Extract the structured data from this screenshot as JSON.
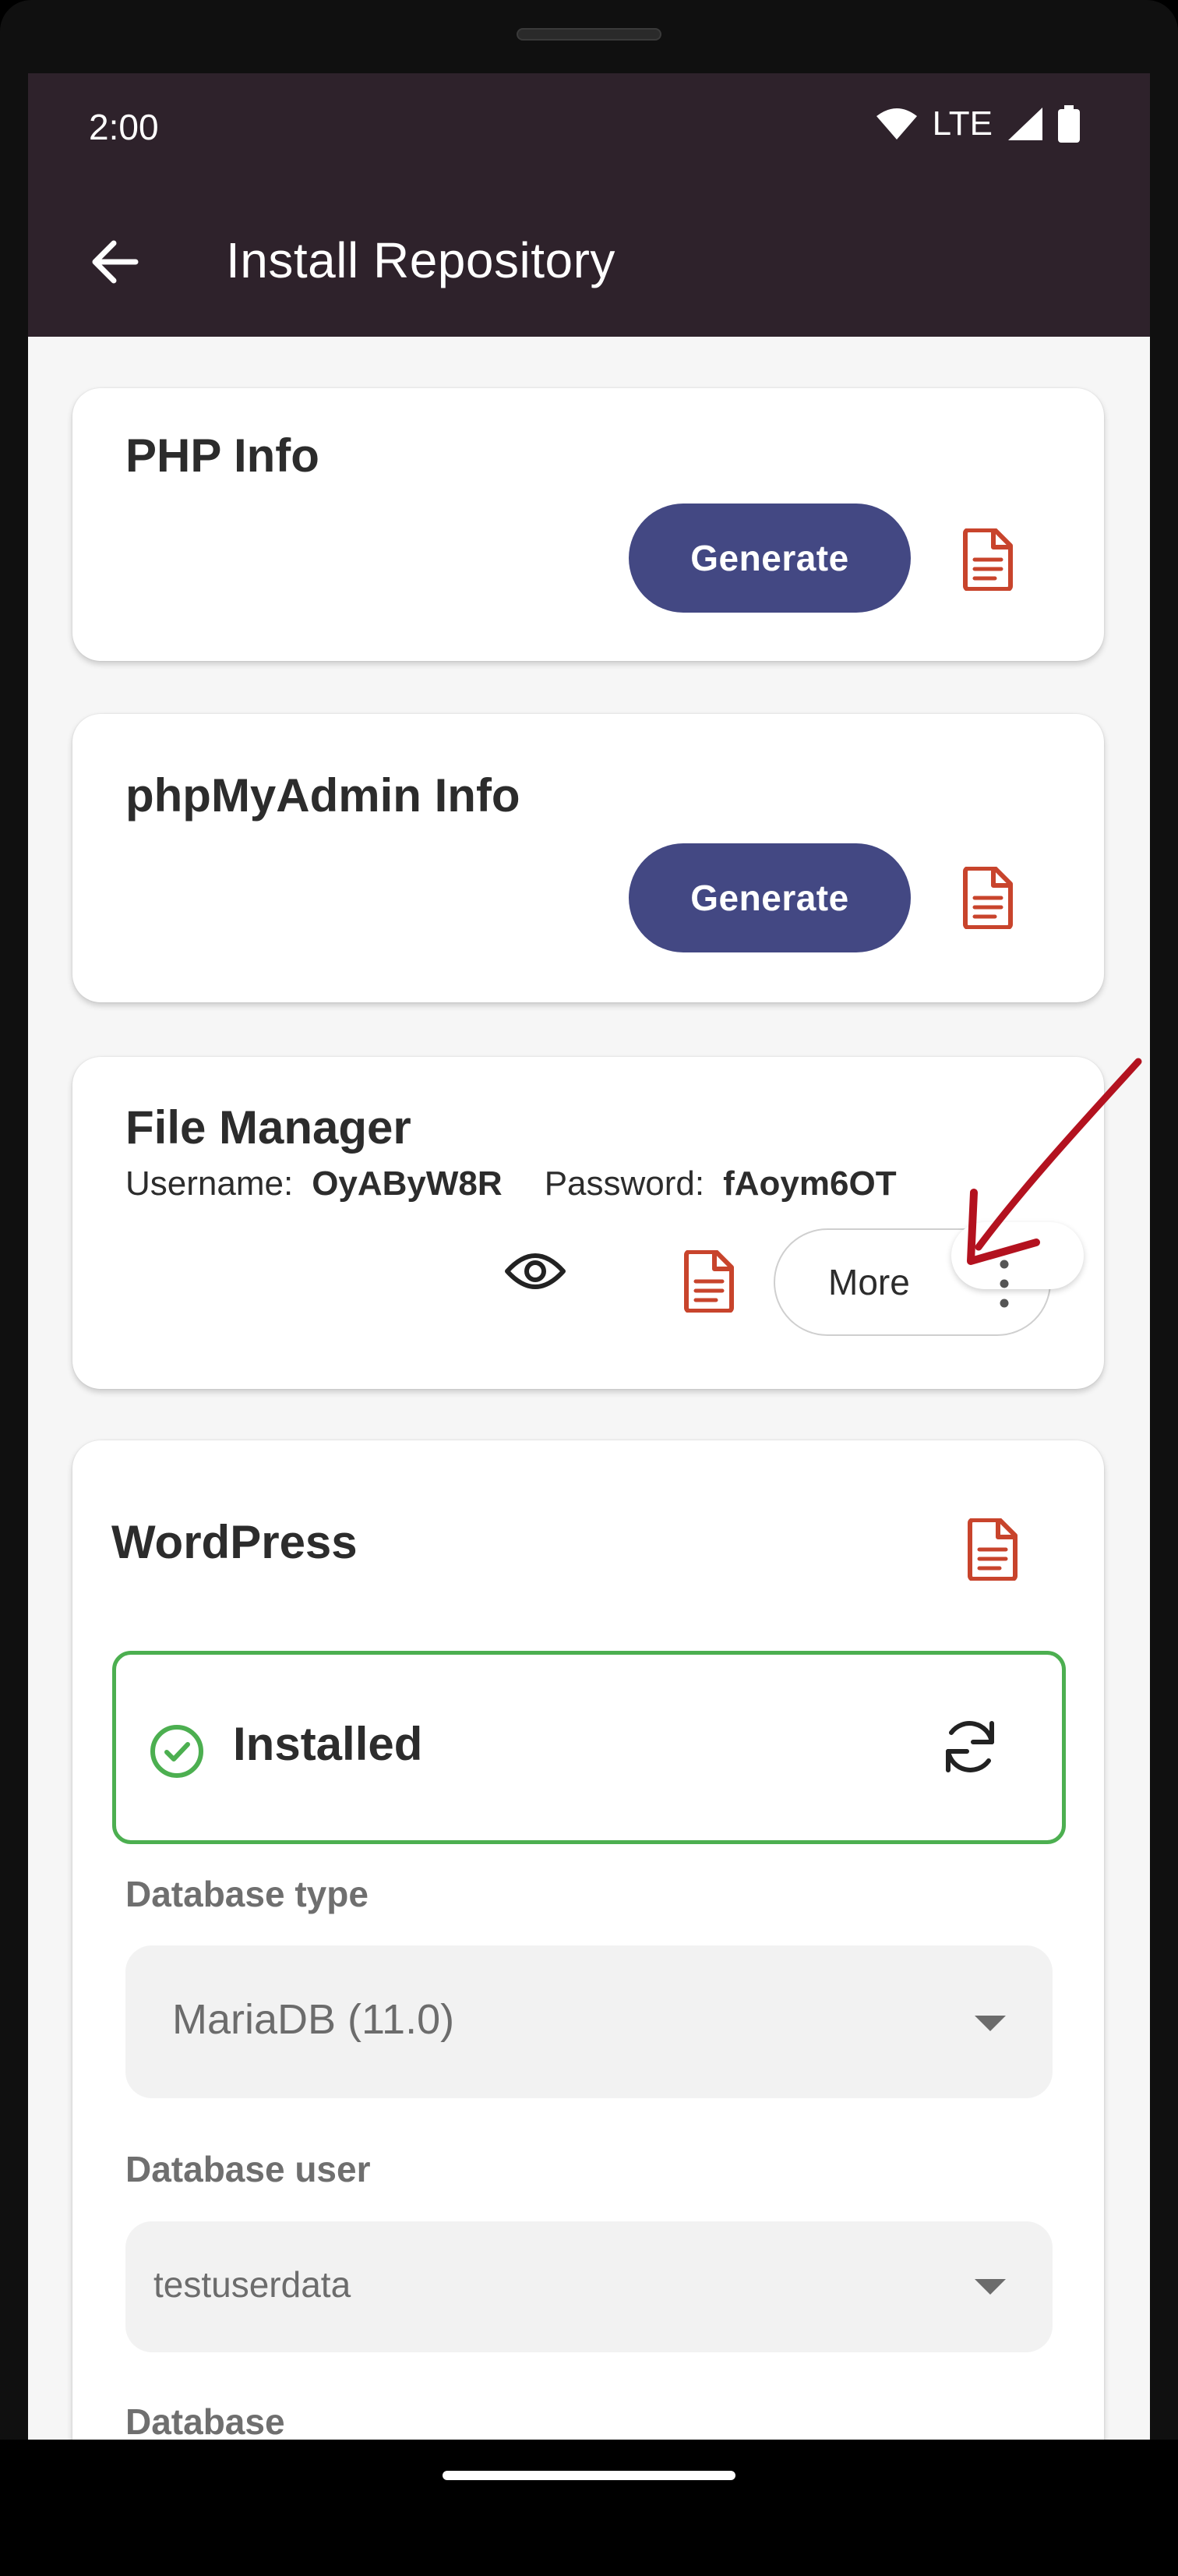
{
  "status_bar": {
    "time": "2:00",
    "network": "LTE",
    "icons": [
      "wifi-icon",
      "signal-icon",
      "battery-icon"
    ]
  },
  "app_bar": {
    "title": "Install Repository",
    "back_icon": "arrow-left-icon"
  },
  "php_info": {
    "title": "PHP Info",
    "generate_label": "Generate",
    "doc_icon": "document-icon"
  },
  "phpmyadmin_info": {
    "title": "phpMyAdmin Info",
    "generate_label": "Generate",
    "doc_icon": "document-icon"
  },
  "file_manager": {
    "title": "File Manager",
    "username_label": "Username:",
    "username_value": "OyAByW8R",
    "password_label": "Password:",
    "password_value": "fAoym6OT",
    "more_label": "More",
    "icons": [
      "eye-icon",
      "document-icon",
      "kebab-menu-icon"
    ]
  },
  "wordpress": {
    "title": "WordPress",
    "status": "Installed",
    "database_type_label": "Database type",
    "database_type_value": "MariaDB (11.0)",
    "database_user_label": "Database user",
    "database_user_value": "testuserdata",
    "next_label": "Database"
  },
  "colors": {
    "appbar": "#2e222b",
    "primary_button": "#434883",
    "doc_icon": "#c8442c",
    "installed_border": "#4caf50",
    "annotation_arrow": "#b3121f"
  }
}
